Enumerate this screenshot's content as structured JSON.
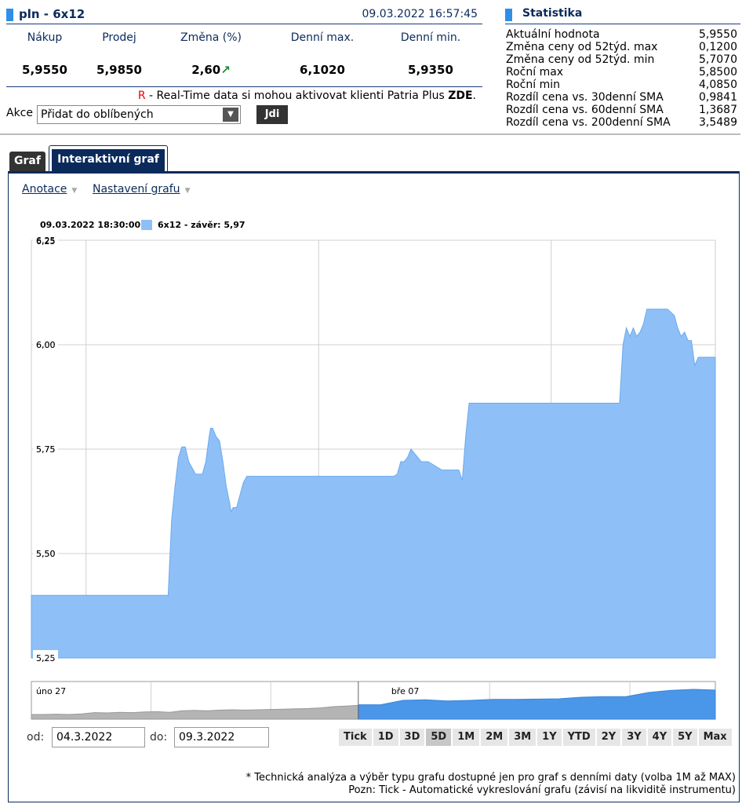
{
  "quote": {
    "title": "pln - 6x12",
    "datetime": "09.03.2022 16:57:45",
    "columns": [
      {
        "header": "Nákup",
        "value": "5,9550"
      },
      {
        "header": "Prodej",
        "value": "5,9850"
      },
      {
        "header": "Změna (%)",
        "value": "2,60"
      },
      {
        "header": "Denní max.",
        "value": "6,1020"
      },
      {
        "header": "Denní min.",
        "value": "5,9350"
      }
    ],
    "change_arrow": "↗",
    "realtime_r": "R",
    "realtime_text": " - Real-Time data si mohou aktivovat klienti Patria Plus ",
    "realtime_link": "ZDE",
    "realtime_end": "."
  },
  "akce": {
    "label": "Akce",
    "selected": "Přidat do oblíbených",
    "go_button": "Jdi"
  },
  "stats": {
    "title": "Statistika",
    "rows": [
      {
        "label": "Aktuální hodnota",
        "value": "5,9550"
      },
      {
        "label": "Změna ceny od 52týd. max",
        "value": "0,1200"
      },
      {
        "label": "Změna ceny od 52týd. min",
        "value": "5,7070"
      },
      {
        "label": "Roční max",
        "value": "5,8500"
      },
      {
        "label": "Roční min",
        "value": "4,0850"
      },
      {
        "label": "Rozdíl cena vs. 30denní SMA",
        "value": "0,9841"
      },
      {
        "label": "Rozdíl cena vs. 60denní SMA",
        "value": "1,3687"
      },
      {
        "label": "Rozdíl cena vs. 200denní SMA",
        "value": "3,5489"
      }
    ]
  },
  "tabs": {
    "graf": "Graf",
    "interactive": "Interaktivní graf"
  },
  "menu": {
    "anotace": "Anotace",
    "nastaveni": "Nastavení grafu",
    "caret": "▼"
  },
  "legend": {
    "date": "09.03.2022 18:30:00",
    "series": "6x12 - závěr: 5,97"
  },
  "chart_data": {
    "type": "area",
    "ylim": [
      5.25,
      6.25
    ],
    "yticks": [
      "6,25",
      "6,00",
      "5,75",
      "5,50",
      "5,25"
    ],
    "ytick_values": [
      6.25,
      6.0,
      5.75,
      5.5,
      5.25
    ],
    "grid": true,
    "color": "#8ec0f7",
    "x": [
      0,
      0.2,
      0.205,
      0.21,
      0.215,
      0.22,
      0.225,
      0.23,
      0.24,
      0.245,
      0.25,
      0.255,
      0.26,
      0.262,
      0.265,
      0.27,
      0.275,
      0.28,
      0.285,
      0.29,
      0.292,
      0.295,
      0.3,
      0.31,
      0.315,
      0.32,
      0.4,
      0.5,
      0.53,
      0.535,
      0.54,
      0.545,
      0.55,
      0.555,
      0.56,
      0.565,
      0.57,
      0.58,
      0.6,
      0.61,
      0.625,
      0.63,
      0.635,
      0.64,
      0.65,
      0.7,
      0.75,
      0.8,
      0.86,
      0.865,
      0.87,
      0.875,
      0.88,
      0.885,
      0.89,
      0.895,
      0.9,
      0.905,
      0.91,
      0.915,
      0.93,
      0.94,
      0.945,
      0.95,
      0.955,
      0.96,
      0.965,
      0.97,
      0.975,
      0.98,
      1.0
    ],
    "y": [
      5.4,
      5.4,
      5.58,
      5.66,
      5.73,
      5.755,
      5.755,
      5.72,
      5.69,
      5.69,
      5.69,
      5.72,
      5.78,
      5.8,
      5.8,
      5.78,
      5.77,
      5.72,
      5.66,
      5.62,
      5.6,
      5.61,
      5.61,
      5.67,
      5.685,
      5.685,
      5.685,
      5.685,
      5.685,
      5.69,
      5.72,
      5.72,
      5.73,
      5.75,
      5.74,
      5.73,
      5.72,
      5.72,
      5.7,
      5.7,
      5.7,
      5.675,
      5.78,
      5.86,
      5.86,
      5.86,
      5.86,
      5.86,
      5.86,
      6.0,
      6.04,
      6.02,
      6.04,
      6.02,
      6.03,
      6.05,
      6.085,
      6.085,
      6.085,
      6.085,
      6.085,
      6.07,
      6.04,
      6.02,
      6.03,
      6.01,
      6.01,
      5.95,
      5.97,
      5.97,
      5.97
    ]
  },
  "navigator": {
    "label_left": "úno 27",
    "label_right": "bře 07",
    "selected_start_fraction": 0.478,
    "history": [
      0.15,
      0.15,
      0.16,
      0.15,
      0.17,
      0.21,
      0.2,
      0.22,
      0.21,
      0.23,
      0.24,
      0.22,
      0.27,
      0.28,
      0.27,
      0.29,
      0.3,
      0.29,
      0.3,
      0.31,
      0.32,
      0.33,
      0.34,
      0.36,
      0.4,
      0.42,
      0.44
    ],
    "selected": [
      0.46,
      0.46,
      0.6,
      0.62,
      0.58,
      0.6,
      0.63,
      0.63,
      0.64,
      0.65,
      0.7,
      0.72,
      0.72,
      0.85,
      0.92,
      0.95,
      0.93
    ]
  },
  "controls": {
    "od_label": "od:",
    "od_value": "04.3.2022",
    "do_label": "do:",
    "do_value": "09.3.2022",
    "ranges": [
      "Tick",
      "1D",
      "3D",
      "5D",
      "1M",
      "2M",
      "3M",
      "1Y",
      "YTD",
      "2Y",
      "3Y",
      "4Y",
      "5Y",
      "Max"
    ],
    "active_range": "5D"
  },
  "footnotes": {
    "line1": "* Technická analýza a výběr typu grafu dostupné jen pro graf s denními daty (volba 1M až MAX)",
    "line2": "Pozn: Tick - Automatické vykreslování grafu (závisí na likviditě instrumentu)"
  }
}
